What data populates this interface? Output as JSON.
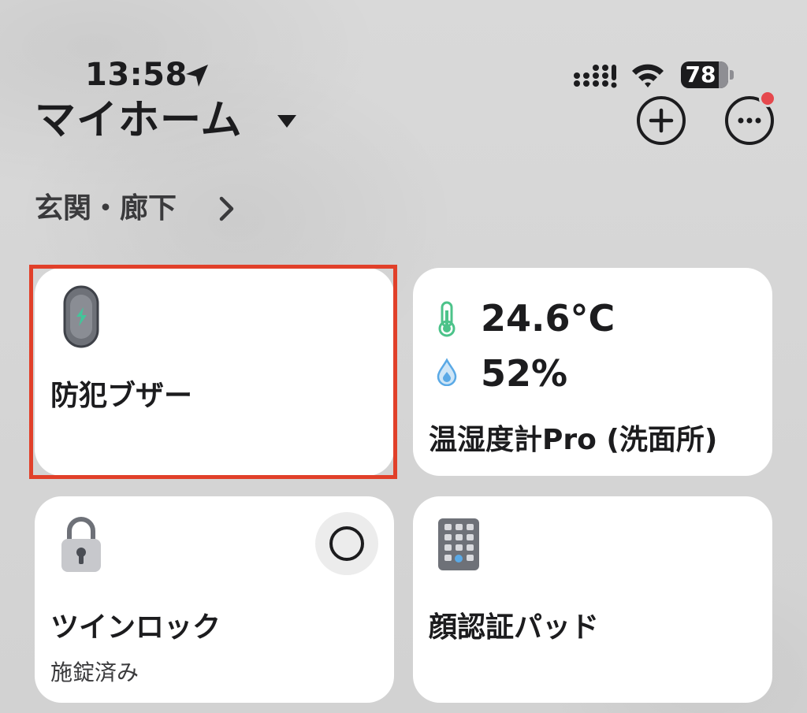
{
  "status_bar": {
    "time": "13:58",
    "battery_level": "78",
    "location_icon": "location-arrow-icon",
    "signal_icon": "cellular-signal-icon",
    "wifi_icon": "wifi-icon"
  },
  "header": {
    "title": "マイホーム",
    "dropdown_icon": "caret-down-icon",
    "add_icon": "plus-circle-icon",
    "more_icon": "ellipsis-circle-icon",
    "has_notification": true
  },
  "section": {
    "title": "玄関・廊下",
    "chevron_icon": "chevron-right-icon"
  },
  "devices": [
    {
      "name": "防犯ブザー",
      "icon": "security-buzzer-icon",
      "highlighted": true
    },
    {
      "name": "温湿度計Pro (洗面所)",
      "icon": "thermometer-icon",
      "temperature": "24.6°C",
      "humidity": "52%",
      "humidity_icon": "water-drop-icon"
    },
    {
      "name": "ツインロック",
      "status": "施錠済み",
      "icon": "padlock-icon",
      "toggle_icon": "circle-toggle-icon"
    },
    {
      "name": "顔認証パッド",
      "icon": "keypad-icon"
    }
  ],
  "colors": {
    "background": "#d7d7d7",
    "card": "#ffffff",
    "highlight_border": "#e1402a",
    "notification_dot": "#e5484d",
    "thermometer": "#4cc38a",
    "water_drop": "#5aa9e6"
  }
}
